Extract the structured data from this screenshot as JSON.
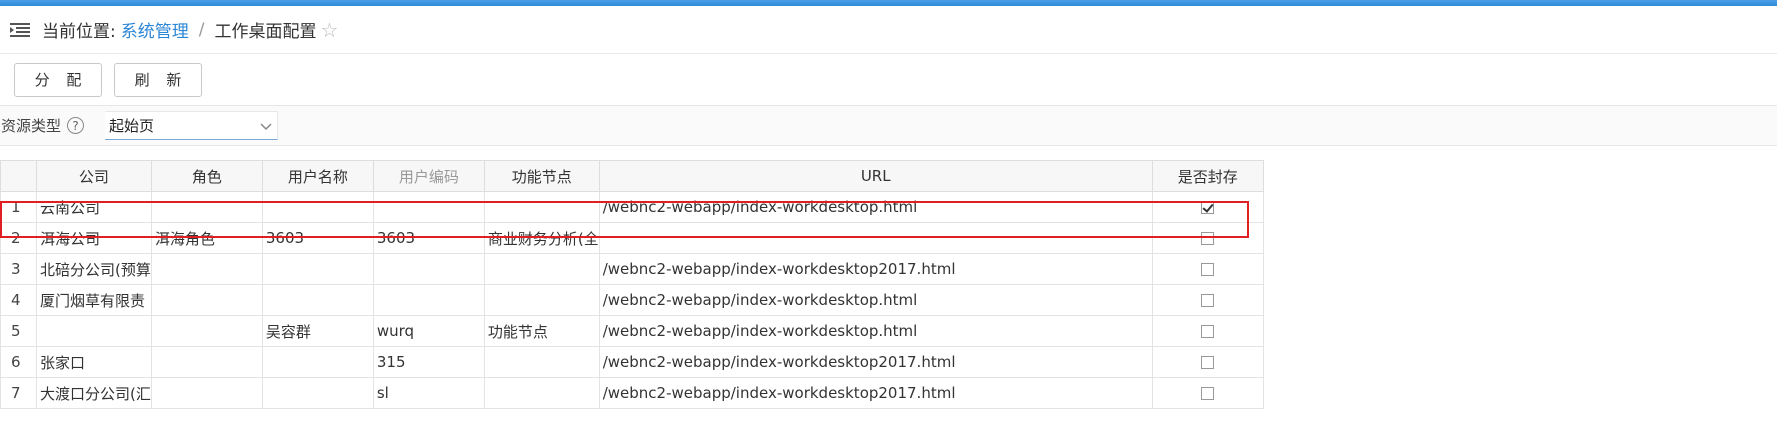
{
  "breadcrumb": {
    "prefix": "当前位置:",
    "link": "系统管理",
    "separator": "/",
    "current": "工作桌面配置"
  },
  "toolbar": {
    "assign_label": "分 配",
    "refresh_label": "刷 新"
  },
  "filter": {
    "label": "资源类型",
    "help": "?",
    "select_value": "起始页"
  },
  "table": {
    "headers": [
      "",
      "公司",
      "角色",
      "用户名称",
      "用户编码",
      "功能节点",
      "URL",
      "是否封存"
    ],
    "rows": [
      {
        "index": "1",
        "company": "云南公司",
        "role": "",
        "user_name": "",
        "user_code": "",
        "node": "",
        "url": "/webnc2-webapp/index-workdesktop.html",
        "sealed": true
      },
      {
        "index": "2",
        "company": "洱海公司",
        "role": "洱海角色",
        "user_name": "3603",
        "user_code": "3603",
        "node": "商业财务分析(全",
        "url": "",
        "sealed": false
      },
      {
        "index": "3",
        "company": "北碚分公司(预算",
        "role": "",
        "user_name": "",
        "user_code": "",
        "node": "",
        "url": "/webnc2-webapp/index-workdesktop2017.html",
        "sealed": false
      },
      {
        "index": "4",
        "company": "厦门烟草有限责",
        "role": "",
        "user_name": "",
        "user_code": "",
        "node": "",
        "url": "/webnc2-webapp/index-workdesktop.html",
        "sealed": false
      },
      {
        "index": "5",
        "company": "",
        "role": "",
        "user_name": "吴容群",
        "user_code": "wurq",
        "node": "功能节点",
        "url": "/webnc2-webapp/index-workdesktop.html",
        "sealed": false
      },
      {
        "index": "6",
        "company": "张家口",
        "role": "",
        "user_name": "",
        "user_code": "315",
        "node": "",
        "url": "/webnc2-webapp/index-workdesktop2017.html",
        "sealed": false
      },
      {
        "index": "7",
        "company": "大渡口分公司(汇",
        "role": "",
        "user_name": "",
        "user_code": "sl",
        "node": "",
        "url": "/webnc2-webapp/index-workdesktop2017.html",
        "sealed": false
      }
    ]
  },
  "colors": {
    "accent": "#2b86d6",
    "highlight": "#e02020"
  }
}
